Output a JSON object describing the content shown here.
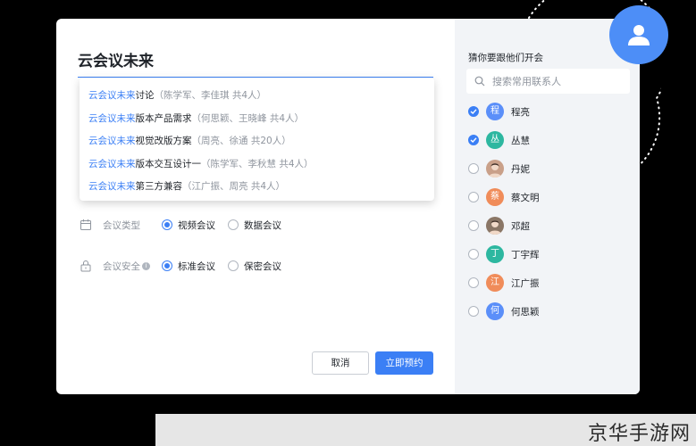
{
  "meeting": {
    "title": "云会议未来",
    "suggestions": [
      {
        "match": "云会议未来",
        "rest": "讨论",
        "meta": "（陈学军、李佳琪 共4人）"
      },
      {
        "match": "云会议未来",
        "rest": "版本产品需求",
        "meta": "（何思颖、王晓峰 共4人）"
      },
      {
        "match": "云会议未来",
        "rest": "视觉改版方案",
        "meta": "（周亮、徐通 共20人）"
      },
      {
        "match": "云会议未来",
        "rest": "版本交互设计一",
        "meta": "（陈学军、李秋慧 共4人）"
      },
      {
        "match": "云会议未来",
        "rest": "第三方兼容",
        "meta": "（江广振、周亮 共4人）"
      }
    ],
    "type": {
      "label": "会议类型",
      "options": [
        "视频会议",
        "数据会议"
      ],
      "selected": "视频会议"
    },
    "security": {
      "label": "会议安全",
      "info": "i",
      "options": [
        "标准会议",
        "保密会议"
      ],
      "selected": "标准会议"
    },
    "buttons": {
      "cancel": "取消",
      "book": "立即预约"
    }
  },
  "contacts": {
    "title": "猜你要跟他们开会",
    "search_placeholder": "搜索常用联系人",
    "items": [
      {
        "name": "程亮",
        "avatar_text": "程",
        "avatar_color": "#5b8ff9",
        "checked": true
      },
      {
        "name": "丛慧",
        "avatar_text": "丛",
        "avatar_color": "#2db7a0",
        "checked": true
      },
      {
        "name": "丹妮",
        "avatar_text": "",
        "avatar_color": "#c9a089",
        "checked": false
      },
      {
        "name": "蔡文明",
        "avatar_text": "蔡",
        "avatar_color": "#f08c5a",
        "checked": false
      },
      {
        "name": "邓超",
        "avatar_text": "",
        "avatar_color": "#8a7666",
        "checked": false
      },
      {
        "name": "丁宇辉",
        "avatar_text": "丁",
        "avatar_color": "#2db7a0",
        "checked": false
      },
      {
        "name": "江广振",
        "avatar_text": "江",
        "avatar_color": "#f08c5a",
        "checked": false
      },
      {
        "name": "何思颖",
        "avatar_text": "何",
        "avatar_color": "#5b8ff9",
        "checked": false
      }
    ]
  },
  "colors": {
    "accent": "#3b7ff5",
    "panel": "#f2f4f7"
  },
  "watermark": "京华手游网"
}
